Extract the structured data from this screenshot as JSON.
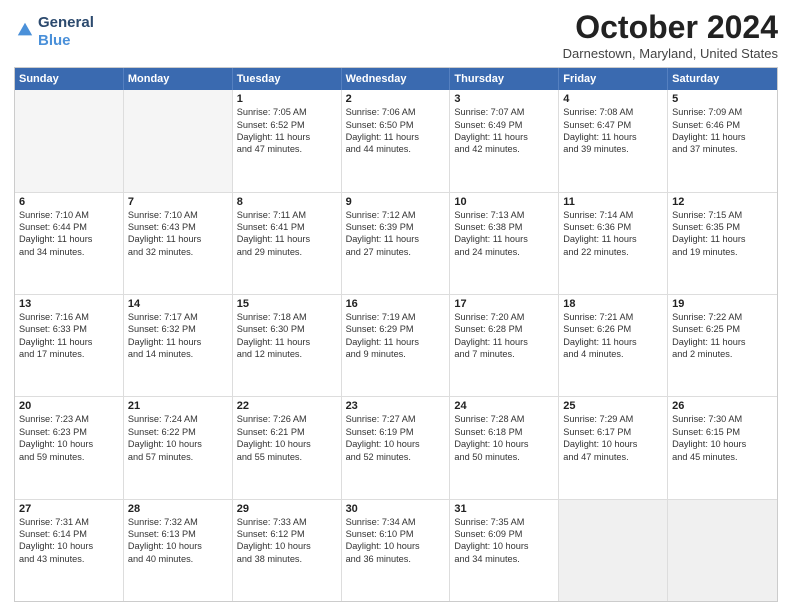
{
  "header": {
    "logo_line1": "General",
    "logo_line2": "Blue",
    "month_title": "October 2024",
    "location": "Darnestown, Maryland, United States"
  },
  "weekdays": [
    "Sunday",
    "Monday",
    "Tuesday",
    "Wednesday",
    "Thursday",
    "Friday",
    "Saturday"
  ],
  "rows": [
    [
      {
        "day": "",
        "lines": [],
        "empty": true
      },
      {
        "day": "",
        "lines": [],
        "empty": true
      },
      {
        "day": "1",
        "lines": [
          "Sunrise: 7:05 AM",
          "Sunset: 6:52 PM",
          "Daylight: 11 hours",
          "and 47 minutes."
        ]
      },
      {
        "day": "2",
        "lines": [
          "Sunrise: 7:06 AM",
          "Sunset: 6:50 PM",
          "Daylight: 11 hours",
          "and 44 minutes."
        ]
      },
      {
        "day": "3",
        "lines": [
          "Sunrise: 7:07 AM",
          "Sunset: 6:49 PM",
          "Daylight: 11 hours",
          "and 42 minutes."
        ]
      },
      {
        "day": "4",
        "lines": [
          "Sunrise: 7:08 AM",
          "Sunset: 6:47 PM",
          "Daylight: 11 hours",
          "and 39 minutes."
        ]
      },
      {
        "day": "5",
        "lines": [
          "Sunrise: 7:09 AM",
          "Sunset: 6:46 PM",
          "Daylight: 11 hours",
          "and 37 minutes."
        ]
      }
    ],
    [
      {
        "day": "6",
        "lines": [
          "Sunrise: 7:10 AM",
          "Sunset: 6:44 PM",
          "Daylight: 11 hours",
          "and 34 minutes."
        ]
      },
      {
        "day": "7",
        "lines": [
          "Sunrise: 7:10 AM",
          "Sunset: 6:43 PM",
          "Daylight: 11 hours",
          "and 32 minutes."
        ]
      },
      {
        "day": "8",
        "lines": [
          "Sunrise: 7:11 AM",
          "Sunset: 6:41 PM",
          "Daylight: 11 hours",
          "and 29 minutes."
        ]
      },
      {
        "day": "9",
        "lines": [
          "Sunrise: 7:12 AM",
          "Sunset: 6:39 PM",
          "Daylight: 11 hours",
          "and 27 minutes."
        ]
      },
      {
        "day": "10",
        "lines": [
          "Sunrise: 7:13 AM",
          "Sunset: 6:38 PM",
          "Daylight: 11 hours",
          "and 24 minutes."
        ]
      },
      {
        "day": "11",
        "lines": [
          "Sunrise: 7:14 AM",
          "Sunset: 6:36 PM",
          "Daylight: 11 hours",
          "and 22 minutes."
        ]
      },
      {
        "day": "12",
        "lines": [
          "Sunrise: 7:15 AM",
          "Sunset: 6:35 PM",
          "Daylight: 11 hours",
          "and 19 minutes."
        ]
      }
    ],
    [
      {
        "day": "13",
        "lines": [
          "Sunrise: 7:16 AM",
          "Sunset: 6:33 PM",
          "Daylight: 11 hours",
          "and 17 minutes."
        ]
      },
      {
        "day": "14",
        "lines": [
          "Sunrise: 7:17 AM",
          "Sunset: 6:32 PM",
          "Daylight: 11 hours",
          "and 14 minutes."
        ]
      },
      {
        "day": "15",
        "lines": [
          "Sunrise: 7:18 AM",
          "Sunset: 6:30 PM",
          "Daylight: 11 hours",
          "and 12 minutes."
        ]
      },
      {
        "day": "16",
        "lines": [
          "Sunrise: 7:19 AM",
          "Sunset: 6:29 PM",
          "Daylight: 11 hours",
          "and 9 minutes."
        ]
      },
      {
        "day": "17",
        "lines": [
          "Sunrise: 7:20 AM",
          "Sunset: 6:28 PM",
          "Daylight: 11 hours",
          "and 7 minutes."
        ]
      },
      {
        "day": "18",
        "lines": [
          "Sunrise: 7:21 AM",
          "Sunset: 6:26 PM",
          "Daylight: 11 hours",
          "and 4 minutes."
        ]
      },
      {
        "day": "19",
        "lines": [
          "Sunrise: 7:22 AM",
          "Sunset: 6:25 PM",
          "Daylight: 11 hours",
          "and 2 minutes."
        ]
      }
    ],
    [
      {
        "day": "20",
        "lines": [
          "Sunrise: 7:23 AM",
          "Sunset: 6:23 PM",
          "Daylight: 10 hours",
          "and 59 minutes."
        ]
      },
      {
        "day": "21",
        "lines": [
          "Sunrise: 7:24 AM",
          "Sunset: 6:22 PM",
          "Daylight: 10 hours",
          "and 57 minutes."
        ]
      },
      {
        "day": "22",
        "lines": [
          "Sunrise: 7:26 AM",
          "Sunset: 6:21 PM",
          "Daylight: 10 hours",
          "and 55 minutes."
        ]
      },
      {
        "day": "23",
        "lines": [
          "Sunrise: 7:27 AM",
          "Sunset: 6:19 PM",
          "Daylight: 10 hours",
          "and 52 minutes."
        ]
      },
      {
        "day": "24",
        "lines": [
          "Sunrise: 7:28 AM",
          "Sunset: 6:18 PM",
          "Daylight: 10 hours",
          "and 50 minutes."
        ]
      },
      {
        "day": "25",
        "lines": [
          "Sunrise: 7:29 AM",
          "Sunset: 6:17 PM",
          "Daylight: 10 hours",
          "and 47 minutes."
        ]
      },
      {
        "day": "26",
        "lines": [
          "Sunrise: 7:30 AM",
          "Sunset: 6:15 PM",
          "Daylight: 10 hours",
          "and 45 minutes."
        ]
      }
    ],
    [
      {
        "day": "27",
        "lines": [
          "Sunrise: 7:31 AM",
          "Sunset: 6:14 PM",
          "Daylight: 10 hours",
          "and 43 minutes."
        ]
      },
      {
        "day": "28",
        "lines": [
          "Sunrise: 7:32 AM",
          "Sunset: 6:13 PM",
          "Daylight: 10 hours",
          "and 40 minutes."
        ]
      },
      {
        "day": "29",
        "lines": [
          "Sunrise: 7:33 AM",
          "Sunset: 6:12 PM",
          "Daylight: 10 hours",
          "and 38 minutes."
        ]
      },
      {
        "day": "30",
        "lines": [
          "Sunrise: 7:34 AM",
          "Sunset: 6:10 PM",
          "Daylight: 10 hours",
          "and 36 minutes."
        ]
      },
      {
        "day": "31",
        "lines": [
          "Sunrise: 7:35 AM",
          "Sunset: 6:09 PM",
          "Daylight: 10 hours",
          "and 34 minutes."
        ]
      },
      {
        "day": "",
        "lines": [],
        "empty": true,
        "shaded": true
      },
      {
        "day": "",
        "lines": [],
        "empty": true,
        "shaded": true
      }
    ]
  ]
}
